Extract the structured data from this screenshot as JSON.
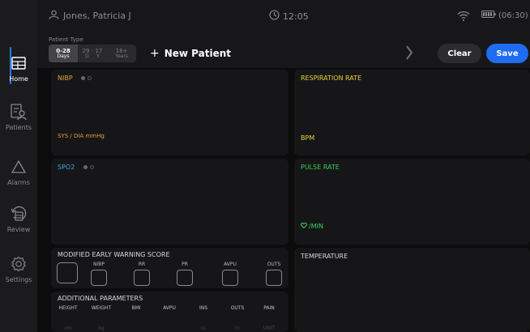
{
  "status_bar": {
    "patient_name": "Jones, Patricia J",
    "time": "12:05",
    "battery_time": "(06:30)"
  },
  "header": {
    "patient_type_label": "Patient Type",
    "patient_types": [
      {
        "range": "0-28",
        "unit": "Days",
        "selected": true
      },
      {
        "range": "29 - 17",
        "unit": "D     Y",
        "selected": false
      },
      {
        "range": "18+",
        "unit": "Years",
        "selected": false
      }
    ],
    "new_patient_plus": "+",
    "new_patient_label": "New Patient",
    "clear_label": "Clear",
    "save_label": "Save"
  },
  "sidebar": {
    "items": [
      {
        "label": "Home",
        "icon": "home-icon",
        "active": true
      },
      {
        "label": "Patients",
        "icon": "patients-icon",
        "active": false
      },
      {
        "label": "Alarms",
        "icon": "alarm-icon",
        "active": false
      },
      {
        "label": "Review",
        "icon": "review-icon",
        "active": false
      },
      {
        "label": "Settings",
        "icon": "settings-icon",
        "active": false
      }
    ]
  },
  "panels": {
    "nibp": {
      "title": "NIBP",
      "unit": "SYS / DIA mmHg",
      "color": "#e2a23a"
    },
    "respiration": {
      "title": "RESPIRATION RATE",
      "unit": "BPM",
      "color": "#e6d33a"
    },
    "spo2": {
      "title": "SPO2",
      "color": "#3aa6ea"
    },
    "pulse": {
      "title": "PULSE RATE",
      "unit_icon": "heart-icon",
      "unit": "/MIN",
      "color": "#3ad05a"
    },
    "temperature": {
      "title": "TEMPERATURE",
      "color": "#d8d8d8"
    }
  },
  "mews": {
    "title": "MODIFIED EARLY WARNING SCORE",
    "labels": [
      "NIBP",
      "RR",
      "PR",
      "AVPU",
      "OUTS"
    ]
  },
  "additional": {
    "title": "ADDITIONAL PARAMETERS",
    "columns": [
      {
        "header": "HEIGHT",
        "unit": "cm"
      },
      {
        "header": "WEIGHT",
        "unit": "kg"
      },
      {
        "header": "BMI",
        "unit": ""
      },
      {
        "header": "AVPU",
        "unit": ""
      },
      {
        "header": "INS",
        "unit": "cc"
      },
      {
        "header": "OUTS",
        "unit": "cc"
      },
      {
        "header": "PAIN",
        "unit": "UNIT"
      }
    ]
  },
  "colors": {
    "accent": "#1e6cf0",
    "nibp": "#e2a23a",
    "respiration": "#e6d33a",
    "spo2": "#3aa6ea",
    "pulse": "#3ad05a"
  }
}
